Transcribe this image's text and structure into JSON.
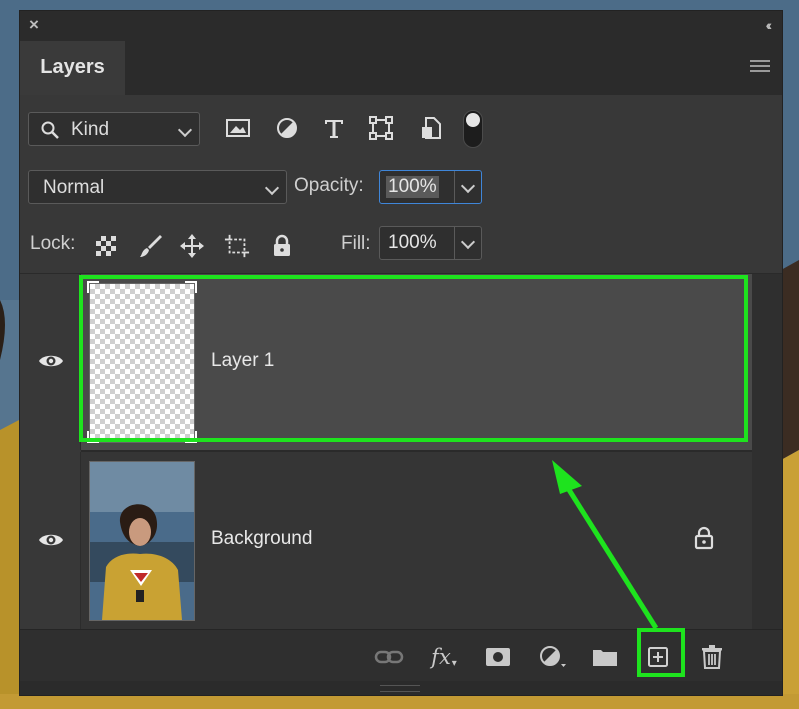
{
  "window": {
    "close_glyph": "×",
    "collapse_glyph": "‹‹"
  },
  "tabs": [
    {
      "label": "Layers",
      "active": true
    }
  ],
  "filter": {
    "kind_label": "Kind",
    "filter_icons": [
      "image-filter-icon",
      "adjustment-filter-icon",
      "type-filter-icon",
      "shape-filter-icon",
      "smart-object-filter-icon"
    ],
    "toggle_on": true
  },
  "blend": {
    "mode": "Normal",
    "opacity_label": "Opacity:",
    "opacity_value": "100%"
  },
  "lock": {
    "label": "Lock:",
    "fill_label": "Fill:",
    "fill_value": "100%",
    "icons": [
      "lock-transparent-pixels-icon",
      "lock-image-pixels-icon",
      "lock-position-icon",
      "lock-artboard-icon",
      "lock-all-icon"
    ]
  },
  "layers": [
    {
      "name": "Layer 1",
      "visible": true,
      "selected": true,
      "thumbnail": "transparent-checkerboard"
    },
    {
      "name": "Background",
      "visible": true,
      "locked": true,
      "thumbnail": "photo-woman-yellow-sweater"
    }
  ],
  "footer": {
    "fx_label": "fx",
    "icons": [
      "link-layers-icon",
      "fx-icon",
      "add-mask-icon",
      "adjustment-layer-icon",
      "group-folder-icon",
      "new-layer-icon",
      "trash-icon"
    ]
  },
  "annotation": {
    "color": "#1ee31e",
    "highlight_target": "Layer 1",
    "arrow_target": "new-layer-button"
  }
}
